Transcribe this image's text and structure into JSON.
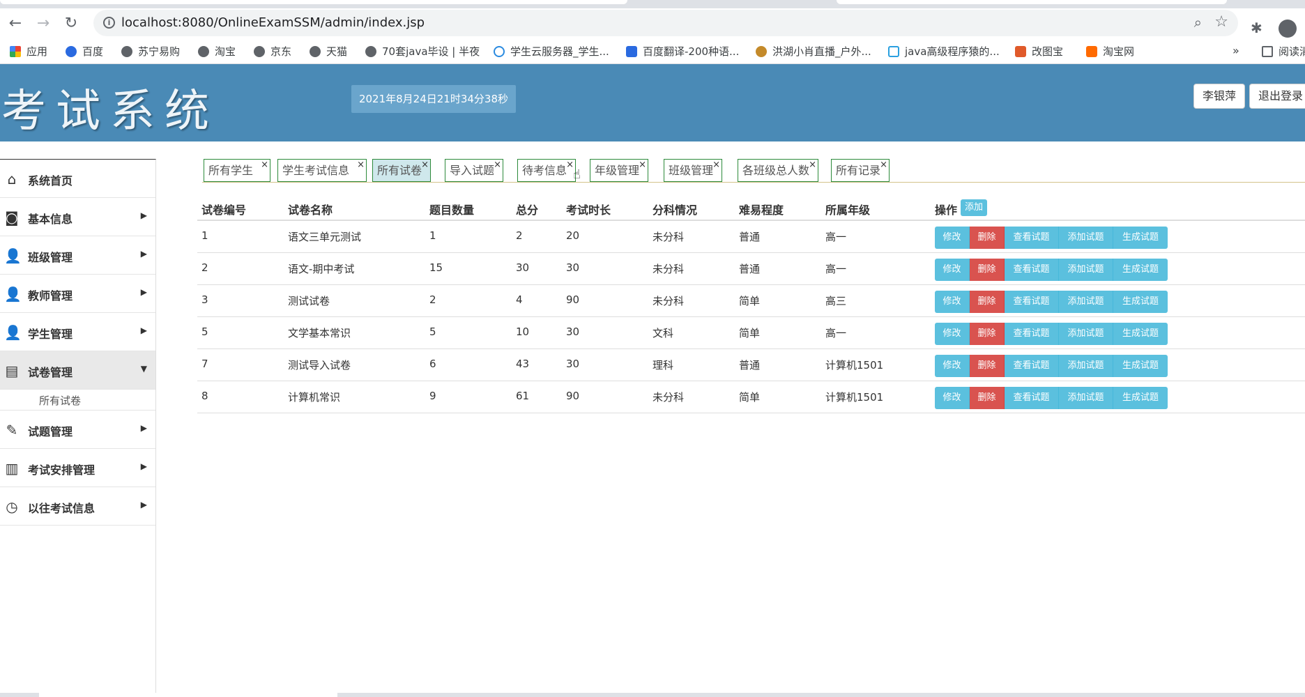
{
  "browser": {
    "url": "localhost:8080/OnlineExamSSM/admin/index.jsp",
    "bookmarks": [
      "应用",
      "百度",
      "苏宁易购",
      "淘宝",
      "京东",
      "天猫",
      "70套java毕设 | 半夜",
      "学生云服务器_学生...",
      "百度翻译-200种语...",
      "洪湖小肖直播_户外...",
      "java高级程序猿的...",
      "改图宝",
      "淘宝网"
    ],
    "more": "»",
    "reading_list": "阅读清单"
  },
  "header": {
    "logo": "考试系统",
    "datetime": "2021年8月24日21时34分38秒",
    "user_name": "李银萍",
    "logout_label": "退出登录"
  },
  "sidebar": {
    "items": [
      {
        "label": "系统首页",
        "icon": "home-icon"
      },
      {
        "label": "基本信息",
        "icon": "monitor-icon"
      },
      {
        "label": "班级管理",
        "icon": "users-icon"
      },
      {
        "label": "教师管理",
        "icon": "teacher-icon"
      },
      {
        "label": "学生管理",
        "icon": "user-icon"
      },
      {
        "label": "试卷管理",
        "icon": "document-icon"
      },
      {
        "label": "试题管理",
        "icon": "edit-icon"
      },
      {
        "label": "考试安排管理",
        "icon": "books-icon"
      },
      {
        "label": "以往考试信息",
        "icon": "clock-icon"
      }
    ],
    "sub_items": [
      "所有试卷"
    ]
  },
  "tabs": [
    {
      "label": "所有学生"
    },
    {
      "label": "学生考试信息"
    },
    {
      "label": "所有试卷"
    },
    {
      "label": "导入试题"
    },
    {
      "label": "待考信息"
    },
    {
      "label": "年级管理"
    },
    {
      "label": "班级管理"
    },
    {
      "label": "各班级总人数"
    },
    {
      "label": "所有记录"
    }
  ],
  "tab_close": "×",
  "table": {
    "headers": [
      "试卷编号",
      "试卷名称",
      "题目数量",
      "总分",
      "考试时长",
      "分科情况",
      "难易程度",
      "所属年级",
      "操作"
    ],
    "add_label": "添加",
    "rows": [
      [
        "1",
        "语文三单元测试",
        "1",
        "2",
        "20",
        "未分科",
        "普通",
        "高一"
      ],
      [
        "2",
        "语文-期中考试",
        "15",
        "30",
        "30",
        "未分科",
        "普通",
        "高一"
      ],
      [
        "3",
        "测试试卷",
        "2",
        "4",
        "90",
        "未分科",
        "简单",
        "高三"
      ],
      [
        "5",
        "文学基本常识",
        "5",
        "10",
        "30",
        "文科",
        "简单",
        "高一"
      ],
      [
        "7",
        "测试导入试卷",
        "6",
        "43",
        "30",
        "理科",
        "普通",
        "计算机1501"
      ],
      [
        "8",
        "计算机常识",
        "9",
        "61",
        "90",
        "未分科",
        "简单",
        "计算机1501"
      ]
    ],
    "actions": [
      "修改",
      "删除",
      "查看试题",
      "添加试题",
      "生成试题"
    ]
  }
}
